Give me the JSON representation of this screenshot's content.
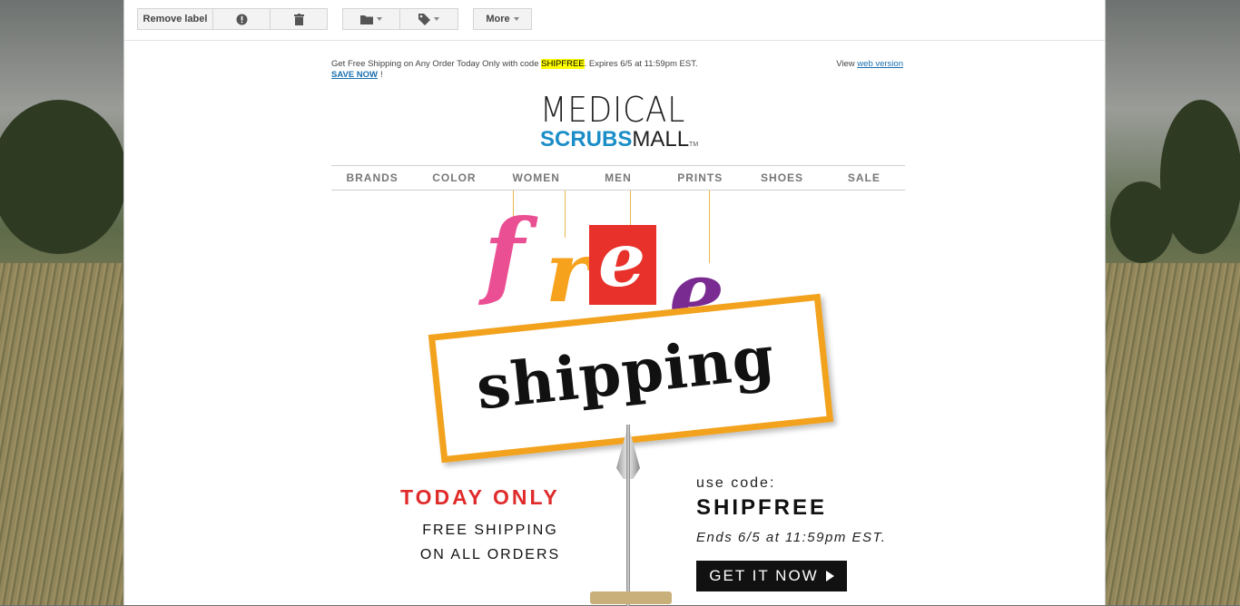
{
  "toolbar": {
    "remove_label": "Remove label",
    "more_label": "More",
    "icons": [
      "report-spam-icon",
      "delete-icon",
      "folder-icon",
      "label-icon"
    ]
  },
  "email": {
    "preheader_text": "Get Free Shipping on Any Order Today Only with code ",
    "preheader_code": "SHIPFREE",
    "preheader_after": ". Expires 6/5 at 11:59pm EST.",
    "save_now": "SAVE NOW",
    "save_bang": "!",
    "view_prefix": "View ",
    "web_version": "web version",
    "logo": {
      "top": "MEDICAL",
      "scrubs": "SCRUBS",
      "mall": "MALL",
      "tm": "TM"
    },
    "nav": [
      "BRANDS",
      "COLOR",
      "WOMEN",
      "MEN",
      "PRINTS",
      "SHOES",
      "SALE"
    ],
    "hero": {
      "free_letters": [
        "f",
        "r",
        "e",
        "e"
      ],
      "shipping": "shipping",
      "today_only": "TODAY ONLY",
      "free_line1": "FREE SHIPPING",
      "free_line2": "ON ALL ORDERS",
      "use_code": "use code:",
      "code": "SHIPFREE",
      "ends": "Ends 6/5 at 11:59pm EST.",
      "cta": "GET IT NOW"
    },
    "colors": {
      "f": "#ea4f93",
      "r": "#f6a21c",
      "e_box": "#e8312a",
      "e_last": "#7a2b91",
      "accent_red": "#e02b2b",
      "link_blue": "#1a6fb0",
      "logo_blue": "#1b8ec8"
    }
  }
}
